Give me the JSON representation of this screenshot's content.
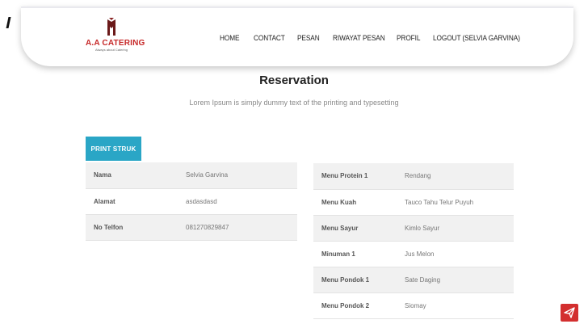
{
  "brand": {
    "name": "A.A CATERING",
    "tagline": "Always about Catering",
    "color": "#c62828"
  },
  "nav": {
    "items": [
      {
        "label": "HOME"
      },
      {
        "label": "CONTACT"
      },
      {
        "label": "PESAN"
      },
      {
        "label": "RIWAYAT PESAN"
      },
      {
        "label": "PROFIL"
      },
      {
        "label": "LOGOUT (SELVIA GARVINA)"
      }
    ]
  },
  "hero": {
    "title": "Reservation",
    "subtitle": "Lorem Ipsum is simply dummy text of the printing and typesetting"
  },
  "actions": {
    "print_label": "PRINT STRUK",
    "print_color": "#2aa6c6"
  },
  "customer": {
    "rows": [
      {
        "label": "Nama",
        "value": "Selvia Garvina"
      },
      {
        "label": "Alamat",
        "value": "asdasdasd"
      },
      {
        "label": "No Telfon",
        "value": "081270829847"
      }
    ]
  },
  "order": {
    "rows": [
      {
        "label": "Menu Protein 1",
        "value": "Rendang"
      },
      {
        "label": "Menu Kuah",
        "value": "Tauco Tahu Telur Puyuh"
      },
      {
        "label": "Menu Sayur",
        "value": "Kimlo Sayur"
      },
      {
        "label": "Minuman 1",
        "value": "Jus Melon"
      },
      {
        "label": "Menu Pondok 1",
        "value": "Sate Daging"
      },
      {
        "label": "Menu Pondok 2",
        "value": "Siomay"
      }
    ]
  },
  "widget": {
    "icon": "send-icon",
    "color": "#d32f2f"
  }
}
